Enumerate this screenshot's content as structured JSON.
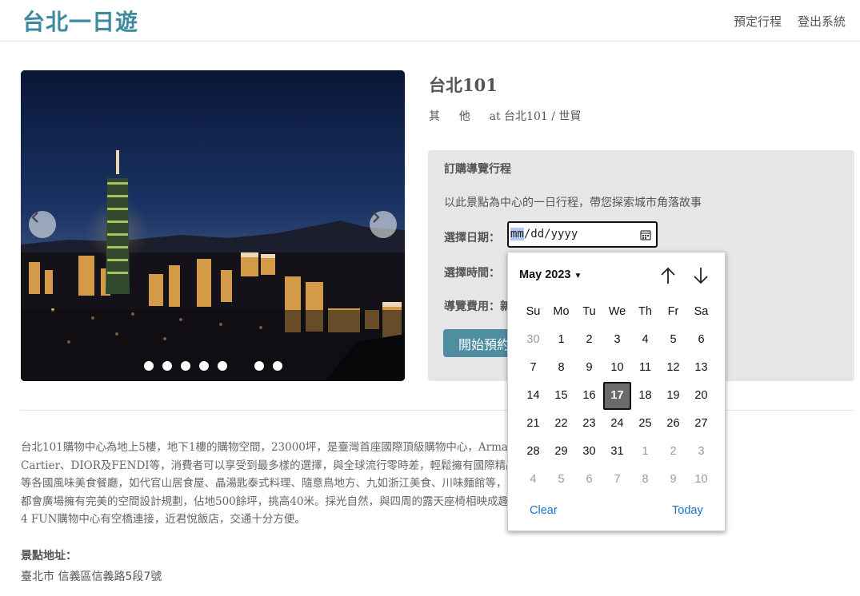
{
  "nav": {
    "brand": "台北一日遊",
    "book_label": "預定行程",
    "logout_label": "登出系統"
  },
  "carousel": {
    "slide_count": 7,
    "active_index": 0
  },
  "attraction": {
    "name": "台北101",
    "category": "其他",
    "at_text": "at 台北101 / 世貿"
  },
  "booking": {
    "heading": "訂購導覽行程",
    "description": "以此景點為中心的一日行程，帶您探索城市角落故事",
    "date_label": "選擇日期：",
    "date_mask_selected": "mm",
    "date_mask_rest": "/dd/yyyy",
    "time_label": "選擇時間：",
    "fee_label": "導覽費用：新",
    "start_button": "開始預約行程"
  },
  "description_lines": [
    "台北101購物中心為地上5樓，地下1樓的購物空間，23000坪，是臺灣首座國際頂級購物中心，Armani、Bottega Veneta、Prada、Gucci、",
    "Cartier、DIOR及FENDI等，消費者可以享受到最多樣的選擇，與全球流行零時差，輕鬆擁有國際精品。美食廣場提供韓式、日式、泰式、中式",
    "等各國風味美食餐廳，如代官山居食屋、晶湯匙泰式料理、隨意鳥地方、九如浙江美食、川味麵館等，提供消費者舒適的用餐環境。4樓",
    "都會廣場擁有完美的空間設計規劃，佔地500餘坪，挑高40米。採光自然，與四周的露天座椅相映成趣，讓人彷彿置身公園。與世貿中心和ATT",
    "4 FUN購物中心有空橋連接，近君悅飯店，交通十分方便。"
  ],
  "address": {
    "label": "景點地址：",
    "value": "臺北市 信義區信義路5段7號"
  },
  "datepicker": {
    "month_label": "May 2023",
    "weekdays": [
      "Su",
      "Mo",
      "Tu",
      "We",
      "Th",
      "Fr",
      "Sa"
    ],
    "weeks": [
      [
        {
          "d": "30",
          "m": true
        },
        {
          "d": "1"
        },
        {
          "d": "2"
        },
        {
          "d": "3"
        },
        {
          "d": "4"
        },
        {
          "d": "5"
        },
        {
          "d": "6"
        }
      ],
      [
        {
          "d": "7"
        },
        {
          "d": "8"
        },
        {
          "d": "9"
        },
        {
          "d": "10"
        },
        {
          "d": "11"
        },
        {
          "d": "12"
        },
        {
          "d": "13"
        }
      ],
      [
        {
          "d": "14"
        },
        {
          "d": "15"
        },
        {
          "d": "16"
        },
        {
          "d": "17",
          "t": true
        },
        {
          "d": "18"
        },
        {
          "d": "19"
        },
        {
          "d": "20"
        }
      ],
      [
        {
          "d": "21"
        },
        {
          "d": "22"
        },
        {
          "d": "23"
        },
        {
          "d": "24"
        },
        {
          "d": "25"
        },
        {
          "d": "26"
        },
        {
          "d": "27"
        }
      ],
      [
        {
          "d": "28"
        },
        {
          "d": "29"
        },
        {
          "d": "30"
        },
        {
          "d": "31"
        },
        {
          "d": "1",
          "m": true
        },
        {
          "d": "2",
          "m": true
        },
        {
          "d": "3",
          "m": true
        }
      ],
      [
        {
          "d": "4",
          "m": true
        },
        {
          "d": "5",
          "m": true
        },
        {
          "d": "6",
          "m": true
        },
        {
          "d": "7",
          "m": true
        },
        {
          "d": "8",
          "m": true
        },
        {
          "d": "9",
          "m": true
        },
        {
          "d": "10",
          "m": true
        }
      ]
    ],
    "clear_label": "Clear",
    "today_label": "Today"
  },
  "colors": {
    "brand": "#3f8aa0",
    "button": "#4f8ea0",
    "panel": "#e6e6e6",
    "link": "#1a73c9",
    "selected_day": "#6b6b6b"
  }
}
